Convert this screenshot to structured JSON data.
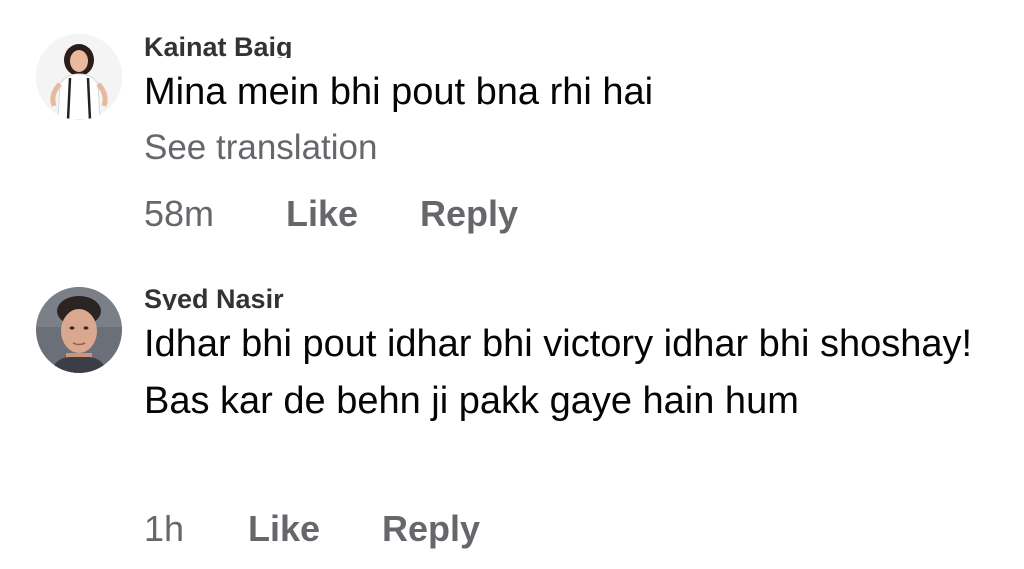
{
  "comments": [
    {
      "author": "Kainat Baig",
      "text": "Mina mein bhi pout bna rhi hai",
      "see_translation": "See translation",
      "time": "58m",
      "like_label": "Like",
      "reply_label": "Reply"
    },
    {
      "author": "Syed Nasir",
      "text": "Idhar bhi pout idhar bhi victory idhar bhi shoshay! Bas kar de behn ji pakk gaye hain hum",
      "time": "1h",
      "like_label": "Like",
      "reply_label": "Reply"
    }
  ]
}
